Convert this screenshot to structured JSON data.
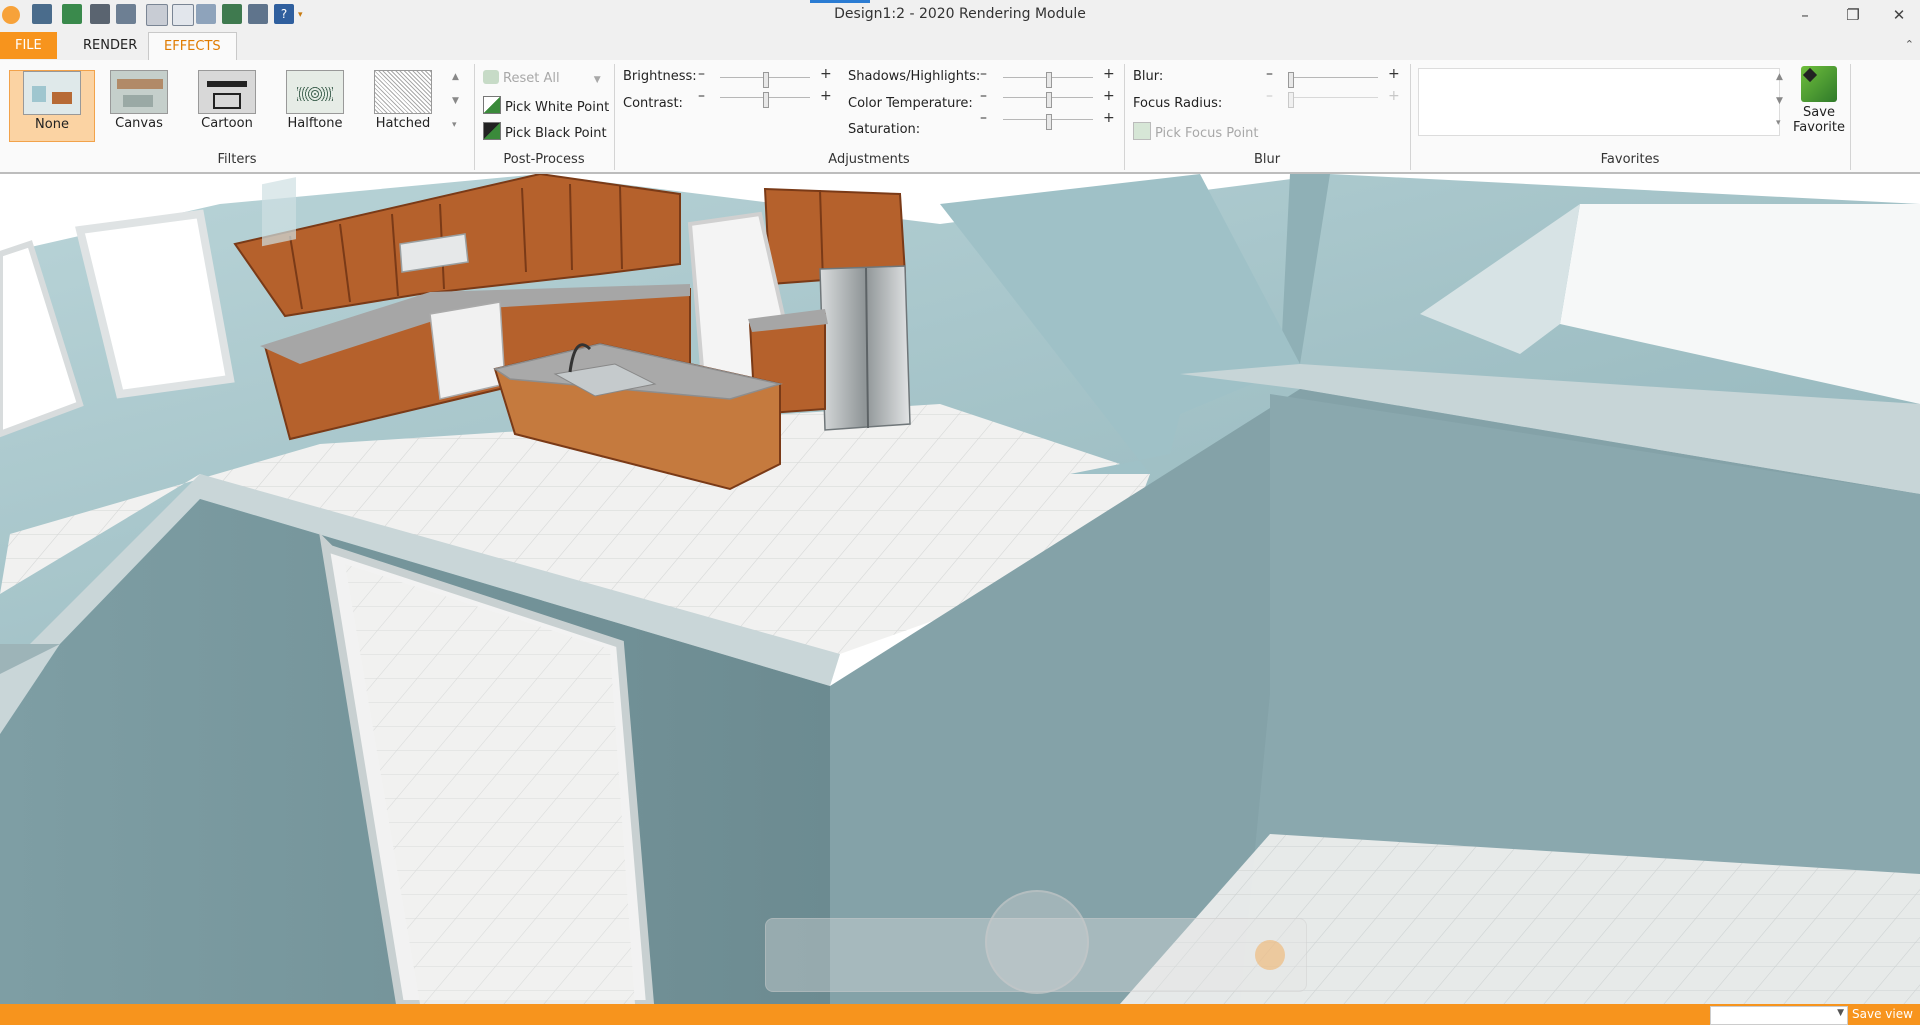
{
  "window": {
    "title": "Design1:2 - 2020 Rendering Module",
    "minimize": "–",
    "restore": "❐",
    "close": "✕"
  },
  "tabs": {
    "file": "FILE",
    "render": "RENDER",
    "effects": "EFFECTS",
    "collapse": "⌃"
  },
  "filters": {
    "group_label": "Filters",
    "items": [
      {
        "label": "None",
        "selected": true
      },
      {
        "label": "Canvas"
      },
      {
        "label": "Cartoon"
      },
      {
        "label": "Halftone"
      },
      {
        "label": "Hatched"
      }
    ]
  },
  "post_process": {
    "group_label": "Post-Process",
    "reset_all": "Reset All",
    "pick_white_point": "Pick White Point",
    "pick_black_point": "Pick Black Point"
  },
  "adjustments": {
    "group_label": "Adjustments",
    "brightness": "Brightness:",
    "contrast": "Contrast:",
    "shadows_highlights": "Shadows/Highlights:",
    "color_temperature": "Color Temperature:",
    "saturation": "Saturation:",
    "minus": "–",
    "plus": "+"
  },
  "blur": {
    "group_label": "Blur",
    "blur_label": "Blur:",
    "focus_radius": "Focus Radius:",
    "pick_focus_point": "Pick Focus Point"
  },
  "favorites": {
    "group_label": "Favorites",
    "save_line1": "Save",
    "save_line2": "Favorite"
  },
  "status": {
    "save_view": "Save view"
  },
  "colors": {
    "accent": "#f7941d",
    "wall": "#a9c9cf",
    "cabinet": "#b5612c",
    "countertop": "#a6a6a6"
  }
}
